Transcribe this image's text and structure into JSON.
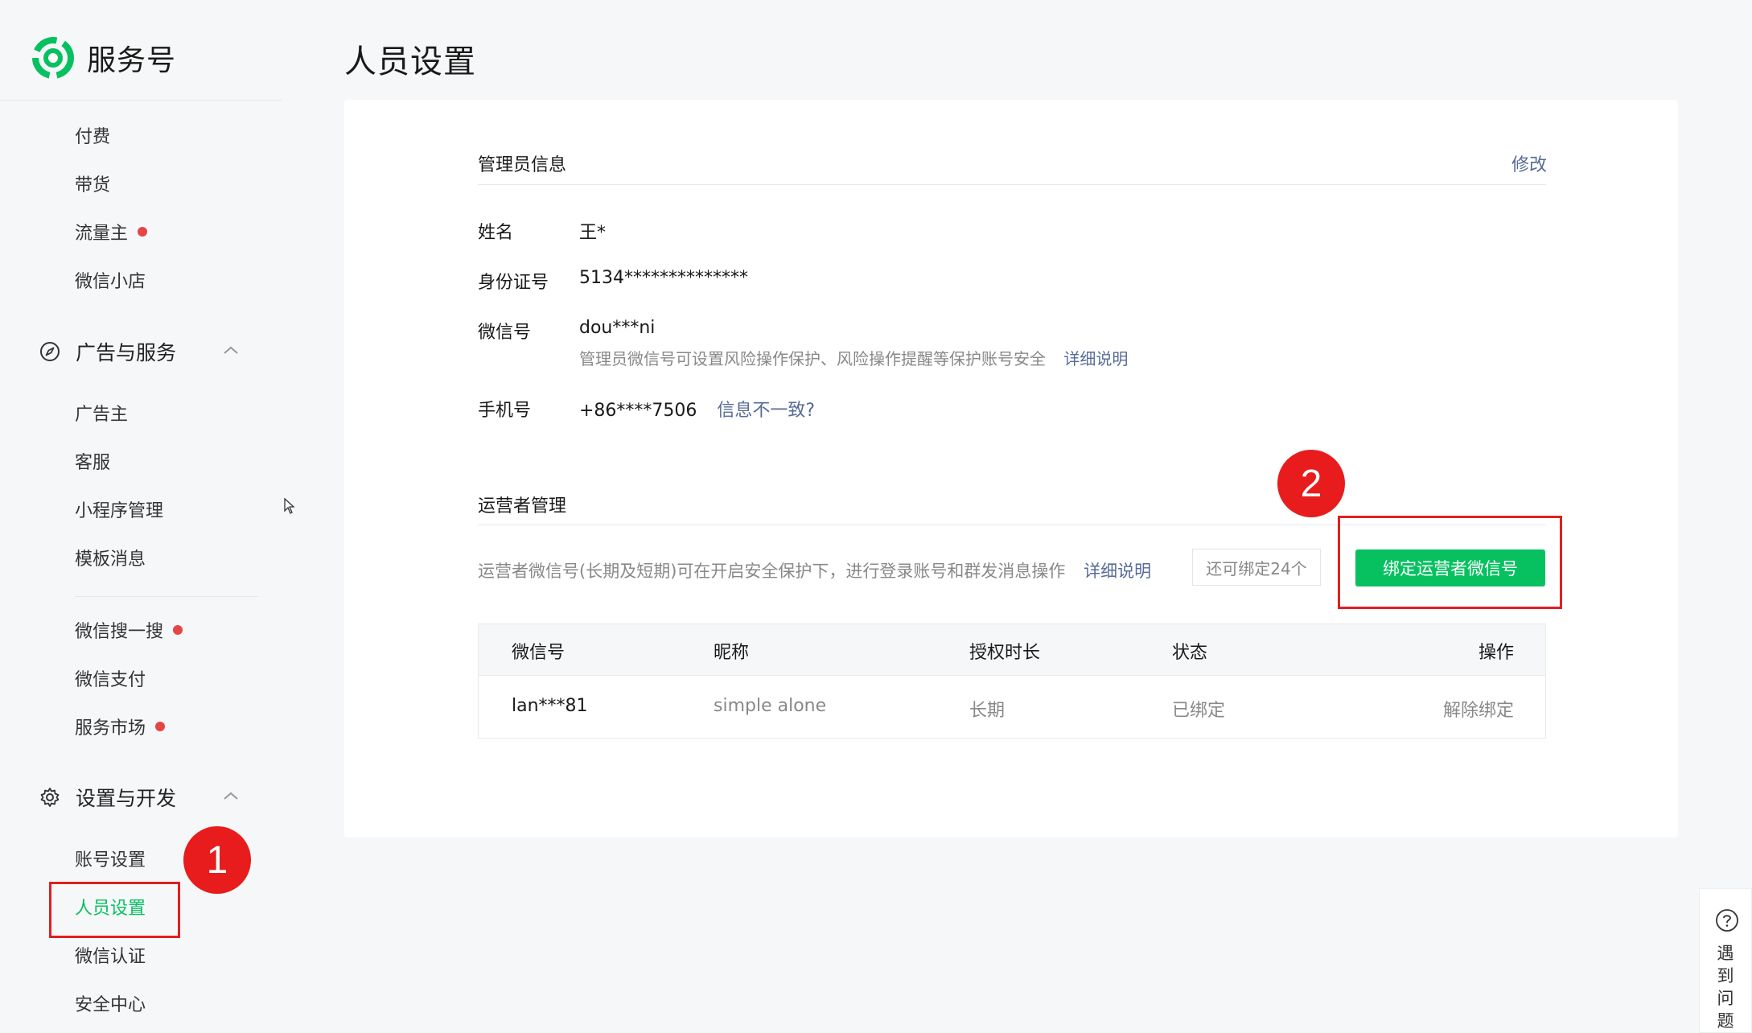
{
  "brand": {
    "name": "服务号",
    "accent": "#07c160"
  },
  "sidebar": {
    "top_items": [
      {
        "label": "付费",
        "dot": false
      },
      {
        "label": "带货",
        "dot": false
      },
      {
        "label": "流量主",
        "dot": true
      },
      {
        "label": "微信小店",
        "dot": false
      }
    ],
    "ads_section": {
      "title": "广告与服务",
      "icon": "compass-icon",
      "items": [
        {
          "label": "广告主",
          "dot": false
        },
        {
          "label": "客服",
          "dot": false
        },
        {
          "label": "小程序管理",
          "dot": false
        },
        {
          "label": "模板消息",
          "dot": false
        },
        {
          "label": "微信搜一搜",
          "dot": true
        },
        {
          "label": "微信支付",
          "dot": false
        },
        {
          "label": "服务市场",
          "dot": true
        }
      ]
    },
    "settings_section": {
      "title": "设置与开发",
      "icon": "gear-icon",
      "items": [
        {
          "label": "账号设置",
          "active": false
        },
        {
          "label": "人员设置",
          "active": true
        },
        {
          "label": "微信认证",
          "active": false
        },
        {
          "label": "安全中心",
          "active": false
        }
      ]
    }
  },
  "page": {
    "title": "人员设置"
  },
  "admin": {
    "title": "管理员信息",
    "edit_label": "修改",
    "name_label": "姓名",
    "name_value": "王*",
    "id_label": "身份证号",
    "id_value": "5134**************",
    "wechat_label": "微信号",
    "wechat_value": "dou***ni",
    "wechat_desc": "管理员微信号可设置风险操作保护、风险操作提醒等保护账号安全",
    "wechat_detail_link": "详细说明",
    "phone_label": "手机号",
    "phone_value": "+86****7506",
    "phone_mismatch_link": "信息不一致?"
  },
  "operators": {
    "title": "运营者管理",
    "desc": "运营者微信号(长期及短期)可在开启安全保护下，进行登录账号和群发消息操作",
    "detail_link": "详细说明",
    "quota": "还可绑定24个",
    "bind_button": "绑定运营者微信号",
    "columns": [
      "微信号",
      "昵称",
      "授权时长",
      "状态",
      "操作"
    ],
    "rows": [
      {
        "wechat": "lan***81",
        "nickname": "simple alone",
        "duration": "长期",
        "status": "已绑定",
        "action": "解除绑定"
      }
    ]
  },
  "annotations": {
    "step1": "1",
    "step2": "2",
    "color": "#e02020"
  },
  "help": {
    "icon": "question-circle-icon",
    "label": "遇到问题"
  }
}
